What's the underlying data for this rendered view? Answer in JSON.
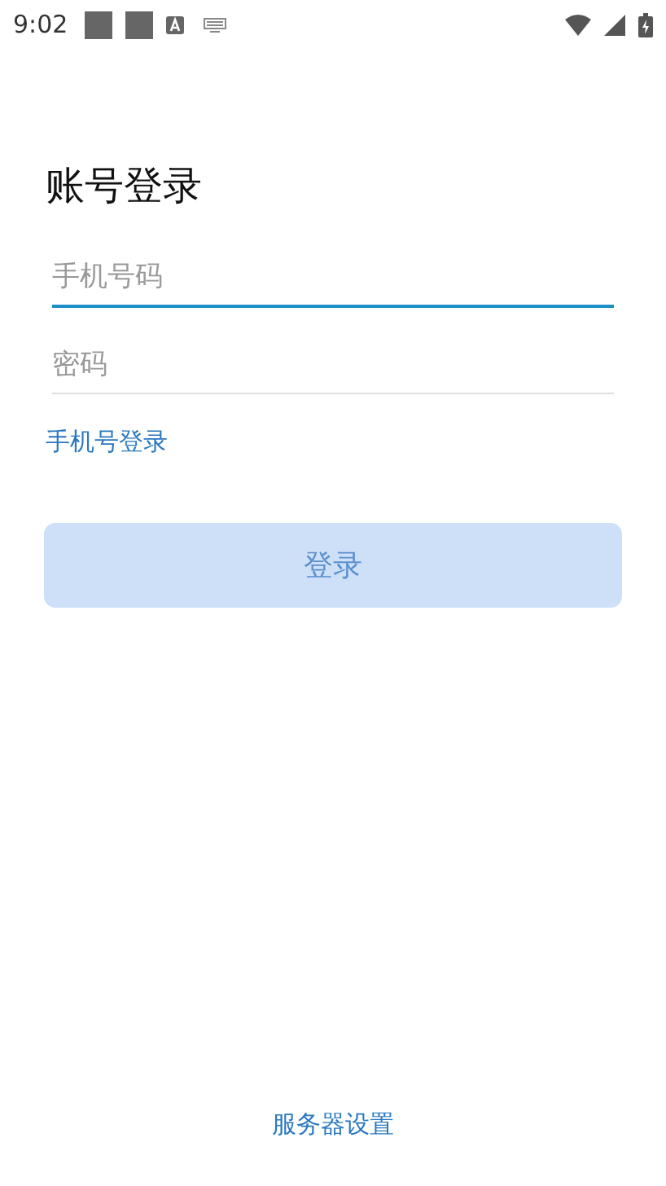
{
  "status_bar": {
    "time": "9:02"
  },
  "title": "账号登录",
  "fields": [
    {
      "placeholder": "手机号码",
      "focused": true
    },
    {
      "placeholder": "密码",
      "focused": false
    }
  ],
  "switch_link": "手机号登录",
  "login_button": {
    "label": "登录",
    "disabled": true
  },
  "footer_link": "服务器设置"
}
